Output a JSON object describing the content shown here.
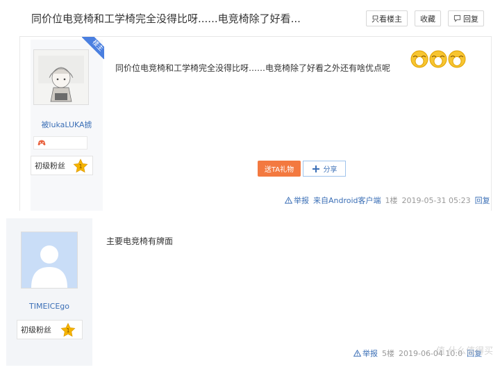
{
  "header": {
    "title": "同价位电竞椅和工学椅完全没得比呀......电竞椅除了好看...",
    "buttons": {
      "only_op": "只看楼主",
      "favorite": "收藏",
      "reply": "回复"
    }
  },
  "post1": {
    "badge": "楼主",
    "username": "被lukaLUKA掳",
    "rank": "初级粉丝",
    "rank_level": "1",
    "content": "同价位电竞椅和工学椅完全没得比呀……电竞椅除了好看之外还有啥优点呢",
    "emoji_icon": "crying-face-icon",
    "gift_label": "送TA礼物",
    "share_label": "分享",
    "report_label": "举报",
    "source": "来自Android客户端",
    "floor": "1楼",
    "time": "2019-05-31 05:23",
    "reply_label": "回复"
  },
  "post2": {
    "username": "TIMEICEgo",
    "rank": "初级粉丝",
    "rank_level": "1",
    "content": "主要电竞椅有牌面",
    "report_label": "举报",
    "floor": "5楼",
    "time": "2019-06-04 10:0",
    "reply_label": "回复"
  },
  "watermark": "值 什么值得买",
  "colors": {
    "link": "#3b6fb6",
    "gift": "#f37940",
    "badge": "#4a7fe0",
    "star": "#f5b400"
  }
}
